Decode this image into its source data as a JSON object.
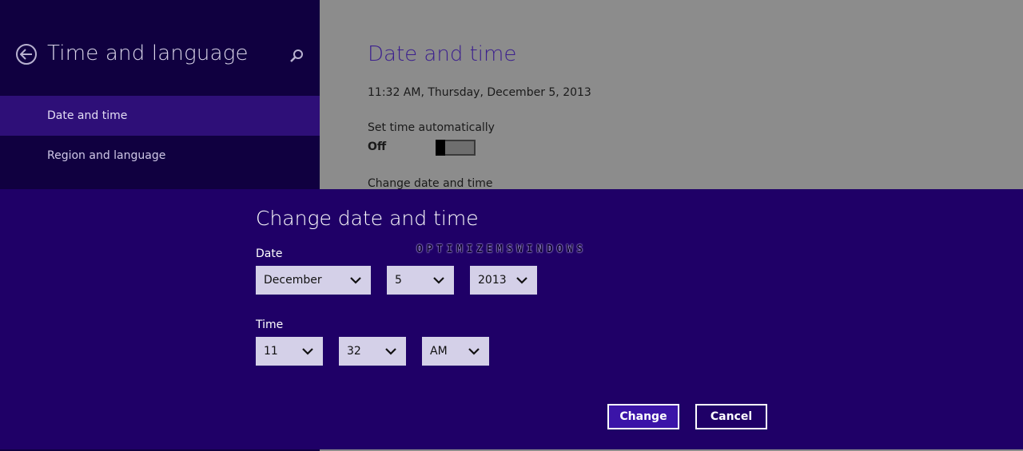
{
  "sidebar": {
    "title": "Time and language",
    "items": [
      {
        "label": "Date and time",
        "selected": true
      },
      {
        "label": "Region and language",
        "selected": false
      }
    ]
  },
  "main": {
    "title": "Date and time",
    "current_datetime": "11:32 AM, Thursday, December 5, 2013",
    "set_time_auto_label": "Set time automatically",
    "toggle_state": "Off",
    "change_section_label": "Change date and time"
  },
  "dialog": {
    "title": "Change date and time",
    "date_label": "Date",
    "date": {
      "month": "December",
      "day": "5",
      "year": "2013"
    },
    "time_label": "Time",
    "time": {
      "hour": "11",
      "minute": "32",
      "period": "AM"
    },
    "change_button": "Change",
    "cancel_button": "Cancel",
    "watermark": "OPTIMIZEMSWINDOWS"
  },
  "colors": {
    "sidebar_bg": "#100040",
    "sidebar_selected": "#2e0f78",
    "dialog_bg": "#1f0067",
    "accent": "#3b1f8e",
    "dimmed_pane": "#8c8c8c"
  },
  "icons": [
    "back-arrow-icon",
    "search-icon",
    "chevron-down-icon"
  ]
}
